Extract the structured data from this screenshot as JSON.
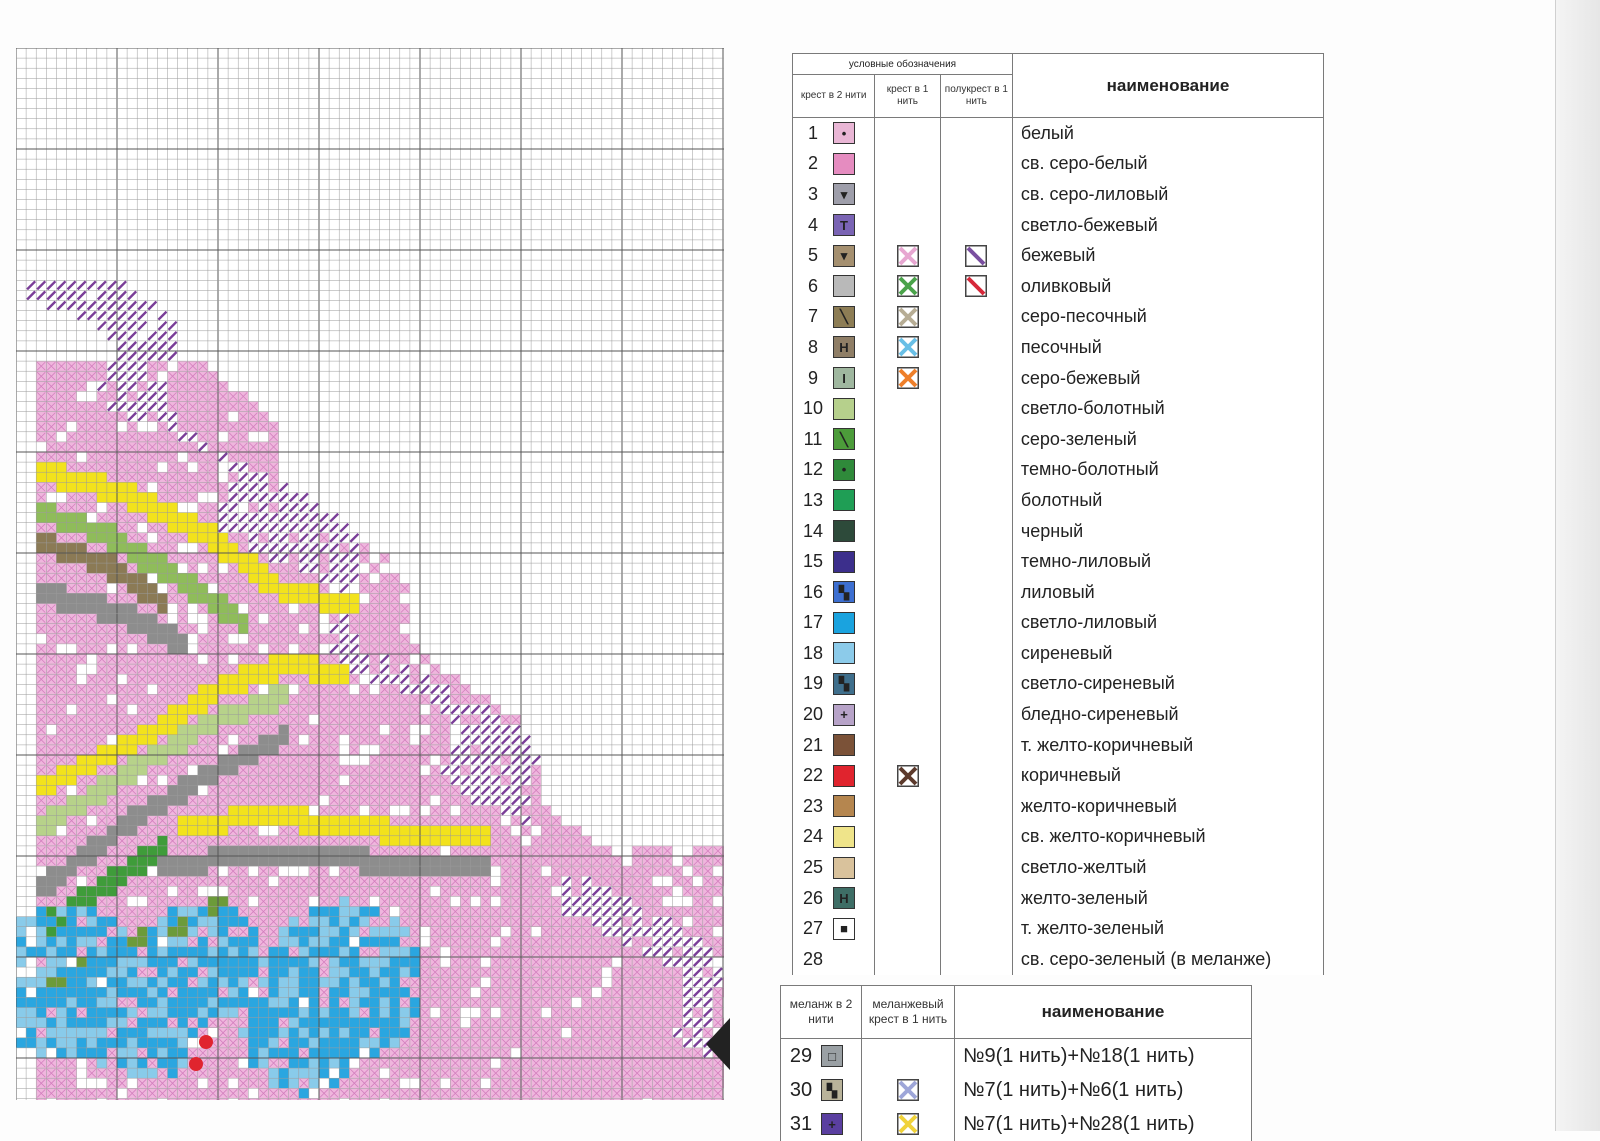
{
  "legend": {
    "header_title": "условные обозначения",
    "col_cross2": "крест в 2 нити",
    "col_cross1": "крест в 1 нить",
    "col_half": "полукрест в 1 нить",
    "col_name": "наименование",
    "rows": [
      {
        "num": "1",
        "name": "белый",
        "fill": "#e9b6d5",
        "glyph": "•"
      },
      {
        "num": "2",
        "name": "св. серо-белый",
        "fill": "#e58cc0",
        "glyph": ""
      },
      {
        "num": "3",
        "name": "св. серо-лиловый",
        "fill": "#9e9eaa",
        "glyph": "▾"
      },
      {
        "num": "4",
        "name": "светло-бежевый",
        "fill": "#7a64b4",
        "glyph": "T"
      },
      {
        "num": "5",
        "name": "бежевый",
        "fill": "#a59070",
        "glyph": "▾",
        "x1": "#e7a7d1",
        "half": "#7a4fa0"
      },
      {
        "num": "6",
        "name": "оливковый",
        "fill": "#b9b9b9",
        "glyph": "",
        "x1": "#4aa34a",
        "half": "#d6283a"
      },
      {
        "num": "7",
        "name": "серо-песочный",
        "fill": "#8d7d55",
        "glyph": "╲",
        "x1": "#b7ad95"
      },
      {
        "num": "8",
        "name": "песочный",
        "fill": "#8f7e66",
        "glyph": "H",
        "x1": "#68bfe6"
      },
      {
        "num": "9",
        "name": "серо-бежевый",
        "fill": "#9fb79f",
        "glyph": "I",
        "x1": "#ee7f2a"
      },
      {
        "num": "10",
        "name": "светло-болотный",
        "fill": "#b6d08c",
        "glyph": ""
      },
      {
        "num": "11",
        "name": "серо-зеленый",
        "fill": "#4c9c3a",
        "glyph": "╲"
      },
      {
        "num": "12",
        "name": "темно-болотный",
        "fill": "#2f8a3a",
        "glyph": "•"
      },
      {
        "num": "13",
        "name": "болотный",
        "fill": "#1f9e55",
        "glyph": ""
      },
      {
        "num": "14",
        "name": "черный",
        "fill": "#2d4a3a",
        "glyph": ""
      },
      {
        "num": "15",
        "name": "темно-лиловый",
        "fill": "#3c2f8c",
        "glyph": ""
      },
      {
        "num": "16",
        "name": "лиловый",
        "fill": "#3d6fd1",
        "glyph": "▚"
      },
      {
        "num": "17",
        "name": "светло-лиловый",
        "fill": "#1aa3df",
        "glyph": ""
      },
      {
        "num": "18",
        "name": "сиреневый",
        "fill": "#8ccbea",
        "glyph": ""
      },
      {
        "num": "19",
        "name": "светло-сиреневый",
        "fill": "#3f6f8c",
        "glyph": "▚"
      },
      {
        "num": "20",
        "name": "бледно-сиреневый",
        "fill": "#b7a3c8",
        "glyph": "+"
      },
      {
        "num": "21",
        "name": "т. желто-коричневый",
        "fill": "#7b5238",
        "glyph": ""
      },
      {
        "num": "22",
        "name": "коричневый",
        "fill": "#e0242e",
        "glyph": "",
        "x1": "#5c3a2c"
      },
      {
        "num": "23",
        "name": "желто-коричневый",
        "fill": "#b5864f",
        "glyph": ""
      },
      {
        "num": "24",
        "name": "св. желто-коричневый",
        "fill": "#efe48a",
        "glyph": ""
      },
      {
        "num": "25",
        "name": "светло-желтый",
        "fill": "#d9c29c",
        "glyph": ""
      },
      {
        "num": "26",
        "name": "желто-зеленый",
        "fill": "#3e6e66",
        "glyph": "H"
      },
      {
        "num": "27",
        "name": "т. желто-зеленый",
        "fill": "#ffffff",
        "glyph": "■"
      },
      {
        "num": "28",
        "name": "св. серо-зеленый (в меланже)"
      }
    ]
  },
  "legend2": {
    "col_melange2": "меланж в 2 нити",
    "col_melange_cross1": "меланжевый крест в 1 нить",
    "col_name": "наименование",
    "rows": [
      {
        "num": "29",
        "name": "№9(1 нить)+№18(1 нить)",
        "fill": "#9aa0a4",
        "glyph": "□"
      },
      {
        "num": "30",
        "name": "№7(1 нить)+№6(1 нить)",
        "fill": "#b9b39a",
        "glyph": "▚",
        "x1": "#9ea6d8"
      },
      {
        "num": "31",
        "name": "№7(1 нить)+№28(1 нить)",
        "fill": "#5a3fa0",
        "glyph": "+",
        "x1": "#f0d23a"
      }
    ]
  }
}
